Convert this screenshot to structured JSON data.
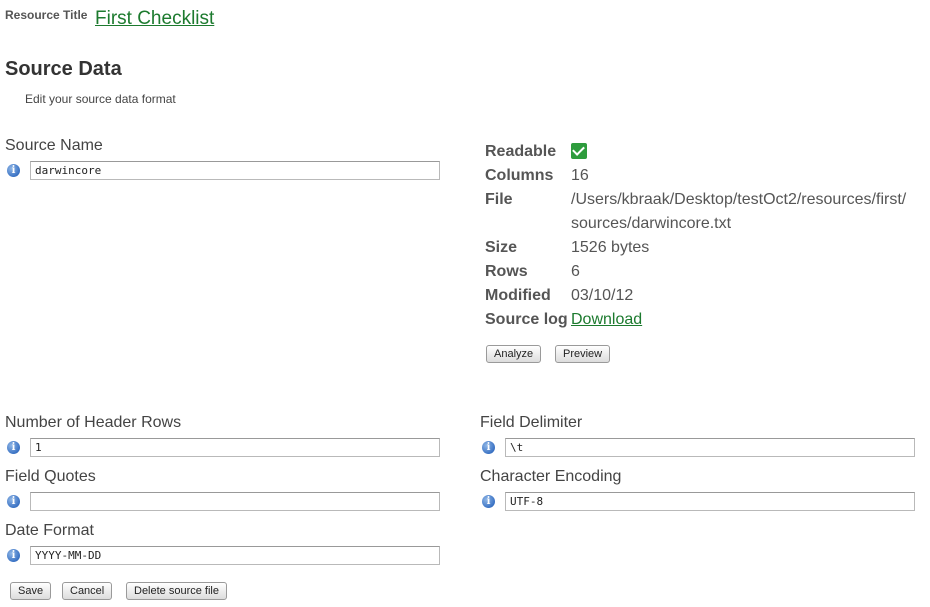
{
  "header": {
    "resource_label": "Resource Title",
    "resource_title": "First Checklist"
  },
  "page": {
    "title": "Source Data",
    "subtitle": "Edit your source data format"
  },
  "source_name": {
    "label": "Source Name",
    "value": "darwincore"
  },
  "properties": {
    "readable_label": "Readable",
    "columns_label": "Columns",
    "columns_value": "16",
    "file_label": "File",
    "file_value_line1": "/Users/kbraak/Desktop/testOct2/resources/first/",
    "file_value_line2": "sources/darwincore.txt",
    "size_label": "Size",
    "size_value": "1526 bytes",
    "rows_label": "Rows",
    "rows_value": "6",
    "modified_label": "Modified",
    "modified_value": "03/10/12",
    "sourcelog_label": "Source log",
    "sourcelog_link": "Download"
  },
  "actions": {
    "analyze": "Analyze",
    "preview": "Preview",
    "save": "Save",
    "cancel": "Cancel",
    "delete": "Delete source file"
  },
  "fields": {
    "header_rows": {
      "label": "Number of Header Rows",
      "value": "1"
    },
    "field_delimiter": {
      "label": "Field Delimiter",
      "value": "\\t"
    },
    "field_quotes": {
      "label": "Field Quotes",
      "value": ""
    },
    "character_encoding": {
      "label": "Character Encoding",
      "value": "UTF-8"
    },
    "date_format": {
      "label": "Date Format",
      "value": "YYYY-MM-DD"
    }
  },
  "icons": {
    "info": "info-icon",
    "check": "check-icon"
  },
  "colors": {
    "link": "#1c7a2e",
    "check": "#2e9c3d",
    "info": "#3a72c4"
  }
}
